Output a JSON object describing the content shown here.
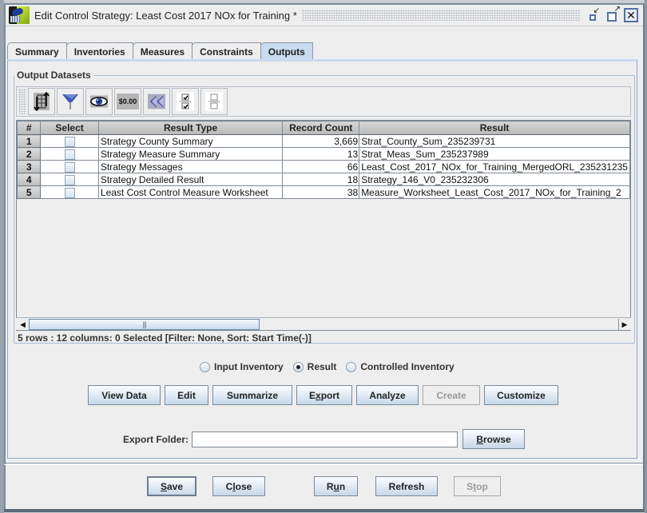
{
  "window": {
    "title": "Edit Control Strategy: Least Cost 2017 NOx for Training *",
    "controls": {
      "iconify": "iconify-icon",
      "maximize": "maximize-icon",
      "close": "close-icon"
    }
  },
  "tabs": [
    {
      "label": "Summary",
      "active": false
    },
    {
      "label": "Inventories",
      "active": false
    },
    {
      "label": "Measures",
      "active": false
    },
    {
      "label": "Constraints",
      "active": false
    },
    {
      "label": "Outputs",
      "active": true
    }
  ],
  "output_datasets": {
    "group_label": "Output Datasets",
    "toolbar": [
      {
        "name": "sort-icon",
        "tooltip": "Sort"
      },
      {
        "name": "filter-icon",
        "tooltip": "Filter"
      },
      {
        "name": "view-icon",
        "tooltip": "View"
      },
      {
        "name": "format-icon",
        "label": "$0.00"
      },
      {
        "name": "reset-icon",
        "tooltip": "Reset"
      },
      {
        "name": "select-all-icon",
        "tooltip": "Select All"
      },
      {
        "name": "clear-all-icon",
        "tooltip": "Clear All"
      }
    ],
    "table": {
      "columns": [
        "#",
        "Select",
        "Result Type",
        "Record Count",
        "Result"
      ],
      "rows": [
        {
          "num": "1",
          "selected": false,
          "result_type": "Strategy County Summary",
          "record_count": "3,669",
          "result": "Strat_County_Sum_235239731"
        },
        {
          "num": "2",
          "selected": false,
          "result_type": "Strategy Measure Summary",
          "record_count": "13",
          "result": "Strat_Meas_Sum_235237989"
        },
        {
          "num": "3",
          "selected": false,
          "result_type": "Strategy Messages",
          "record_count": "66",
          "result": "Least_Cost_2017_NOx_for_Training_MergedORL_235231235"
        },
        {
          "num": "4",
          "selected": false,
          "result_type": "Strategy Detailed Result",
          "record_count": "18",
          "result": "Strategy_146_V0_235232306"
        },
        {
          "num": "5",
          "selected": false,
          "result_type": "Least Cost Control Measure Worksheet",
          "record_count": "38",
          "result": "Measure_Worksheet_Least_Cost_2017_NOx_for_Training_2"
        }
      ]
    },
    "status": "5 rows : 12 columns: 0 Selected [Filter: None, Sort: Start Time(-)]"
  },
  "dataset_type": {
    "options": [
      "Input Inventory",
      "Result",
      "Controlled Inventory"
    ],
    "selected": "Result"
  },
  "action_buttons": {
    "view_data": "View Data",
    "edit": "Edit",
    "summarize": "Summarize",
    "export_pre": "E",
    "export_u": "x",
    "export_post": "port",
    "analyze": "Analyze",
    "create": "Create",
    "customize": "Customize"
  },
  "export": {
    "label": "Export Folder:",
    "value": "",
    "browse_u": "B",
    "browse_post": "rowse"
  },
  "footer": {
    "save_u": "S",
    "save_post": "ave",
    "close_pre": "C",
    "close_u": "l",
    "close_post": "ose",
    "run_pre": "R",
    "run_u": "u",
    "run_post": "n",
    "refresh": "Refresh",
    "stop_pre": "S",
    "stop_u": "t",
    "stop_post": "op"
  }
}
